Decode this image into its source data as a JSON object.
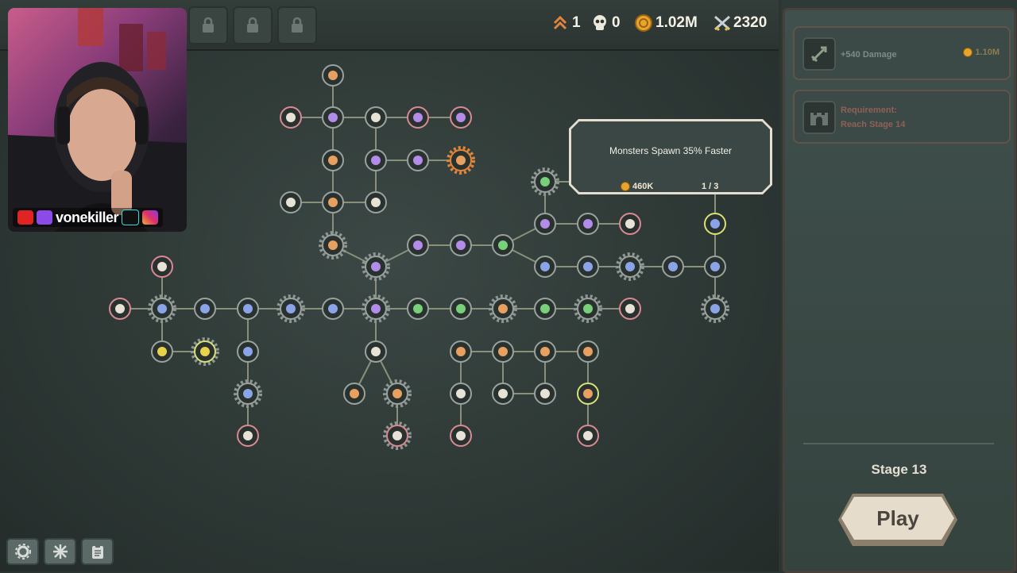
{
  "hud": {
    "rank_value": "1",
    "kills_value": "0",
    "gold_value": "1.02M",
    "power_value": "2320"
  },
  "streamer": {
    "handle": "vonekiller"
  },
  "tooltip": {
    "title": "Monsters Spawn 35% Faster",
    "cost": "460K",
    "level": "1 / 3"
  },
  "side_panel": {
    "upgrade_card": {
      "label": "+540 Damage",
      "price": "1.10M"
    },
    "locked_card": {
      "line1": "Requirement:",
      "line2": "Reach Stage 14"
    },
    "stage_label": "Stage 13",
    "play_label": "Play"
  },
  "colors": {
    "node_fill": "#2a3230",
    "ring_normal": "#9aa29f",
    "ring_pink": "#d88a94",
    "ring_orange": "#e0853a",
    "ring_yellow": "#d8e07a",
    "ring_green": "#6fc07a",
    "line": "#8a8f7c",
    "purple_icon": "#b28ce8",
    "blue_icon": "#8aa4e8",
    "green_icon": "#78d07a",
    "orange_icon": "#e8a060"
  }
}
